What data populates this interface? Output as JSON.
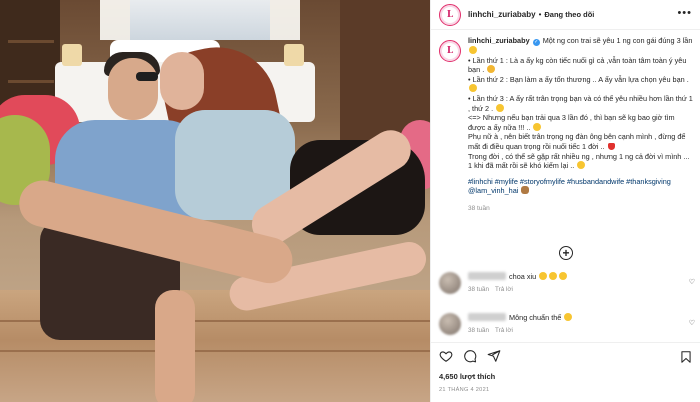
{
  "post": {
    "username": "linhchi_zuriababy",
    "avatar_letter": "L",
    "separator": "•",
    "follow_status": "Đang theo dõi",
    "more_label": "•••"
  },
  "caption": {
    "lines": [
      "Một ng con trai sẽ yêu 1 ng con gái đúng 3 lần",
      "• Lần thứ 1 : Là a ấy kg còn tiếc nuối gì cả ,vẫn toàn tâm toàn ý yêu bạn .",
      "• Lần thứ 2 : Bạn làm a ấy tổn thương .. A ấy vẫn lựa chọn yêu bạn .",
      "• Lần thứ 3 : A ấy rất trân trọng bạn và có thể yêu nhiều hơn lần thứ 1 , thứ 2 .",
      "<=> Nhưng nếu bạn trải qua 3 lần đó , thì bạn sẽ kg bao giờ tìm được a ấy nữa !!! ..",
      "Phụ nữ à , nên biết trân trọng ng đàn ông bên cạnh mình , đừng để mất đi điều quan trọng rồi nuối tiếc 1 đời ..",
      "Trong đời , có thể sẽ gặp rất nhiều ng , nhưng 1 ng cả đời vì mình ... 1 khi đã mất rồi sẽ khó kiếm lại .."
    ],
    "hashtags": "#linhchi #mylife #storyofmylife #husbandandwife #thanksgiving @lam_vinh_hai",
    "time_ago": "38 tuần"
  },
  "load_more_label": "+",
  "comments": [
    {
      "text": "choa xiu",
      "time": "38 tuần",
      "reply": "Trả lời"
    },
    {
      "text": "Mông chuẩn thế",
      "time": "38 tuần",
      "reply": "Trả lời"
    }
  ],
  "stats": {
    "likes": "4,650 lượt thích",
    "date": "21 THÁNG 4 2021"
  },
  "colors": {
    "link": "#00376b",
    "verified": "#3897f0",
    "muted": "#8e8e8e",
    "border": "#efefef"
  }
}
